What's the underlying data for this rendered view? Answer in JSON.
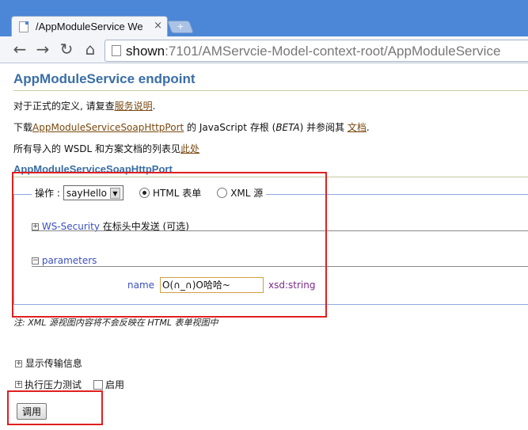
{
  "browser": {
    "tab_title": "/AppModuleService We",
    "tab_close": "×",
    "new_tab": "+",
    "url_host": "shown",
    "url_rest": ":7101/AMServcie-Model-context-root/AppModuleService",
    "nav": {
      "back": "←",
      "forward": "→",
      "reload": "↻",
      "home": "⌂"
    }
  },
  "page": {
    "title": "AppModuleService endpoint",
    "p1_text": "对于正式的定义, 请复查",
    "p1_link": "服务说明",
    "p1_end": ".",
    "p2_a": "下载",
    "p2_link": "AppModuleServiceSoapHttpPort",
    "p2_b": " 的 JavaScript 存根 (",
    "p2_beta": "BETA",
    "p2_c": ") 并参阅其 ",
    "p2_link2": "文档",
    "p2_end": ".",
    "p3_text": "所有导入的 WSDL 和方案文档的列表见",
    "p3_link": "此处",
    "port_title": "AppModuleServiceSoapHttpPort",
    "op_label": "操作 :",
    "op_value": "sayHello",
    "op_arrow": "▼",
    "radio_html": "HTML 表单",
    "radio_xml": "XML 源",
    "ws_expander": "+",
    "ws_link": "WS-Security",
    "ws_text": " 在标头中发送 (可选)",
    "param_expander": "−",
    "param_link": "parameters",
    "name_label": "name",
    "name_value": "O(∩_∩)O哈哈~",
    "type_label": "xsd:string",
    "note": "注: XML 源视图内容将不会反映在 HTML 表单视图中",
    "show_expander": "+",
    "show_text": "显示传输信息",
    "stress_expander": "+",
    "stress_text": "执行压力测试",
    "enable_text": "启用",
    "invoke_label": "调用"
  },
  "colors": {
    "accent": "#3a6ea5",
    "highlight_box": "#e02020",
    "link": "#3b50c0"
  }
}
